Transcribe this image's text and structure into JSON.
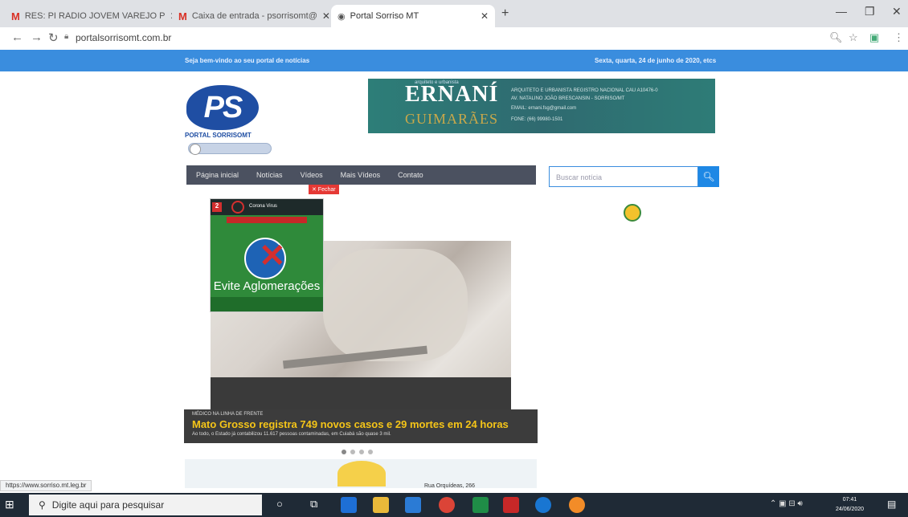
{
  "browser": {
    "tabs": [
      {
        "label": "RES: PI RADIO JOVEM VAREJO P",
        "icon": "gmail-icon"
      },
      {
        "label": "Caixa de entrada - psorrisomt@",
        "icon": "gmail-icon"
      },
      {
        "label": "Portal Sorriso MT",
        "icon": "globe-icon",
        "active": true
      }
    ],
    "new_tab": "+",
    "url": "portalsorrisomt.com.br",
    "status_url": "https://www.sorriso.mt.leg.br"
  },
  "site": {
    "welcome": "Seja bem-vindo ao seu portal de notícias",
    "date": "Sexta, quarta, 24 de junho de 2020, etcs",
    "logo_initials": "PS",
    "logo_name": "PORTAL SORRISOMT",
    "banner": {
      "top_small": "arquiteto e urbanista",
      "name_top": "ERNANÍ",
      "name_bottom": "GUIMARÃES",
      "line1": "ARQUITETO E URBANISTA REGISTRO NACIONAL CAU A10476-0",
      "line2": "AV. NATALINO JOÃO BRESCANSIN - SORRISO/MT",
      "line3": "EMAIL: ernani.fsg@gmail.com",
      "line4": "FONE: (66) 99980-1501"
    },
    "nav": [
      "Página inicial",
      "Notícias",
      "Vídeos",
      "Mais Vídeos",
      "Contato"
    ],
    "close_popup": "✕ Fechar",
    "search_placeholder": "Buscar notícia",
    "popup": {
      "badge": "2",
      "header": "Corona Virus",
      "evite": "Evite Aglomerações"
    },
    "slide": {
      "kicker": "MÉDICO NA LINHA DE FRENTE",
      "title": "Mato Grosso registra 749 novos casos e 29 mortes em 24 horas",
      "summary": "Ao todo, o Estado já contabilizou 11.617 pessoas contaminadas, em Cuiabá são quase 3 mil."
    },
    "bottom_ad_text": "Rua Orquídeas, 266"
  },
  "taskbar": {
    "search_placeholder": "Digite aqui para pesquisar",
    "time": "07:41",
    "date": "24/06/2020"
  }
}
